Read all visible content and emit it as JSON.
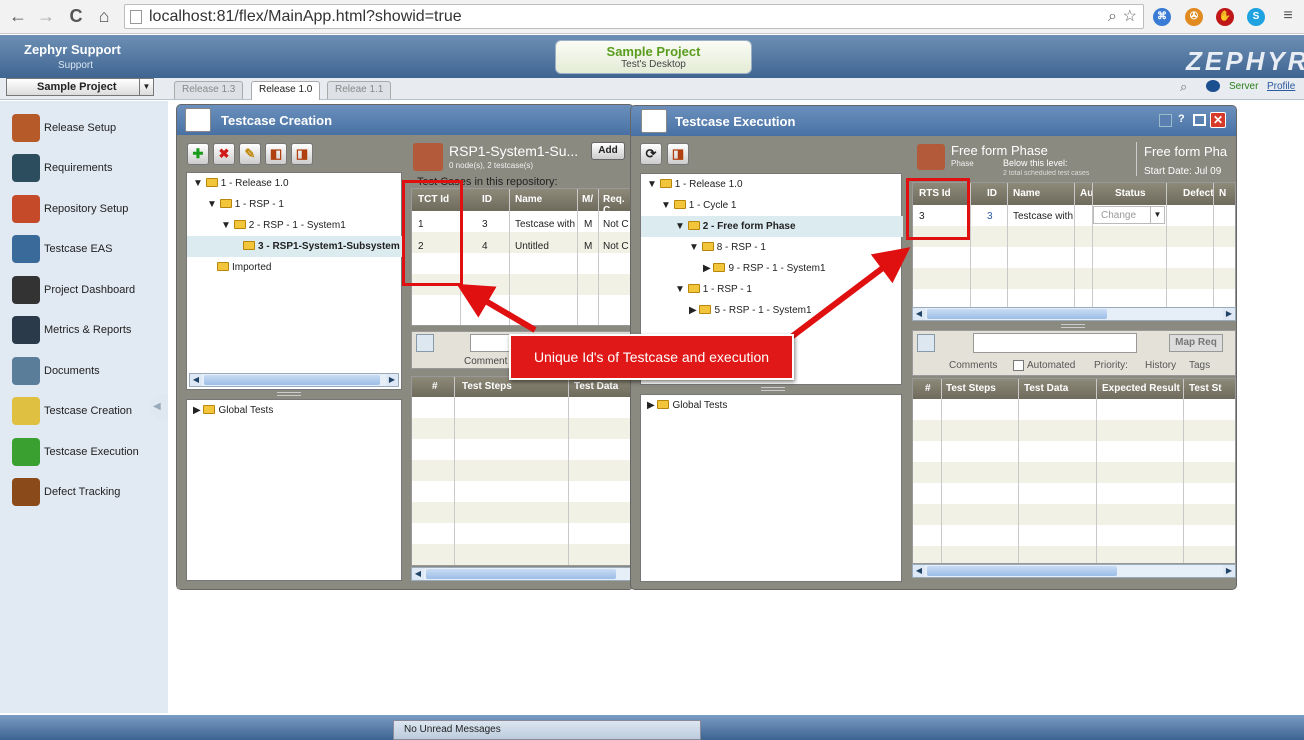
{
  "browser": {
    "url": "localhost:81/flex/MainApp.html?showid=true",
    "back": "←",
    "forward": "→",
    "reload": "C",
    "home": "⌂"
  },
  "header": {
    "brand_title": "Zephyr Support",
    "brand_sub": "Support",
    "project_name": "Sample Project",
    "project_sub": "Test's Desktop",
    "logo": "ZEPHYR",
    "server_link": "Server",
    "profile_link": "Profile"
  },
  "toolbar": {
    "project_select": "Sample Project",
    "release_tabs": [
      "Release 1.3",
      "Release 1.0",
      "Releae 1.1"
    ],
    "active_release_index": 1
  },
  "sidebar": {
    "items": [
      {
        "label": "Release Setup",
        "icon": "release-setup-icon",
        "color": "#b75a2a"
      },
      {
        "label": "Requirements",
        "icon": "requirements-icon",
        "color": "#2c4d5e"
      },
      {
        "label": "Repository Setup",
        "icon": "repository-setup-icon",
        "color": "#c44a2a"
      },
      {
        "label": "Testcase EAS",
        "icon": "testcase-eas-icon",
        "color": "#3a6a9a"
      },
      {
        "label": "Project Dashboard",
        "icon": "project-dashboard-icon",
        "color": "#333333"
      },
      {
        "label": "Metrics & Reports",
        "icon": "metrics-reports-icon",
        "color": "#2a3a4a"
      },
      {
        "label": "Documents",
        "icon": "documents-icon",
        "color": "#5a7d9a"
      },
      {
        "label": "Testcase Creation",
        "icon": "testcase-creation-icon",
        "color": "#e0c040"
      },
      {
        "label": "Testcase Execution",
        "icon": "testcase-execution-icon",
        "color": "#3aa030"
      },
      {
        "label": "Defect Tracking",
        "icon": "defect-tracking-icon",
        "color": "#8a4a1a"
      }
    ]
  },
  "creation": {
    "title": "Testcase Creation",
    "tree": [
      "1 - Release 1.0",
      "1 - RSP - 1",
      "2 - RSP - 1 - System1",
      "3 - RSP1-System1-Subsystem",
      "Imported"
    ],
    "global_tests": "Global Tests",
    "repo_title": "RSP1-System1-Su...",
    "repo_sub": "0 node(s), 2 testcase(s)",
    "add_button": "Add",
    "repo_caption": "Test Cases in this repository:",
    "columns": [
      "TCT Id",
      "ID",
      "Name",
      "M/",
      "Req. C"
    ],
    "rows": [
      [
        "1",
        "3",
        "Testcase with",
        "M",
        "Not C"
      ],
      [
        "2",
        "4",
        "Untitled",
        "M",
        "Not C"
      ]
    ],
    "detail_tab": "Comment",
    "step_columns": [
      "#",
      "Test Steps",
      "Test Data"
    ]
  },
  "execution": {
    "title": "Testcase Execution",
    "tree": [
      "1 - Release 1.0",
      "1 - Cycle 1",
      "2 - Free form Phase",
      "8 - RSP - 1",
      "9 - RSP - 1 - System1",
      "1 - RSP - 1",
      "5 - RSP - 1 - System1"
    ],
    "global_tests": "Global Tests",
    "phase_title": "Free form Phase",
    "phase_label": "Phase",
    "phase_level": "Below this level:",
    "phase_count": "2 total scheduled test cases",
    "phase_title2": "Free form Pha",
    "start_date": "Start Date: Jul 09",
    "columns": [
      "RTS Id",
      "ID",
      "Name",
      "Au",
      "Status",
      "Defect",
      "N"
    ],
    "rows": [
      {
        "rts": "3",
        "id": "3",
        "name": "Testcase with",
        "status": "Change"
      }
    ],
    "map_req": "Map Req",
    "tabs": [
      "Comments",
      "Automated",
      "Priority:",
      "History",
      "Tags"
    ],
    "step_columns": [
      "#",
      "Test Steps",
      "Test Data",
      "Expected Result",
      "Test St"
    ]
  },
  "annotation": {
    "text": "Unique Id's of Testcase and execution",
    "color": "#e01818"
  },
  "status": {
    "messages": "No Unread Messages"
  }
}
